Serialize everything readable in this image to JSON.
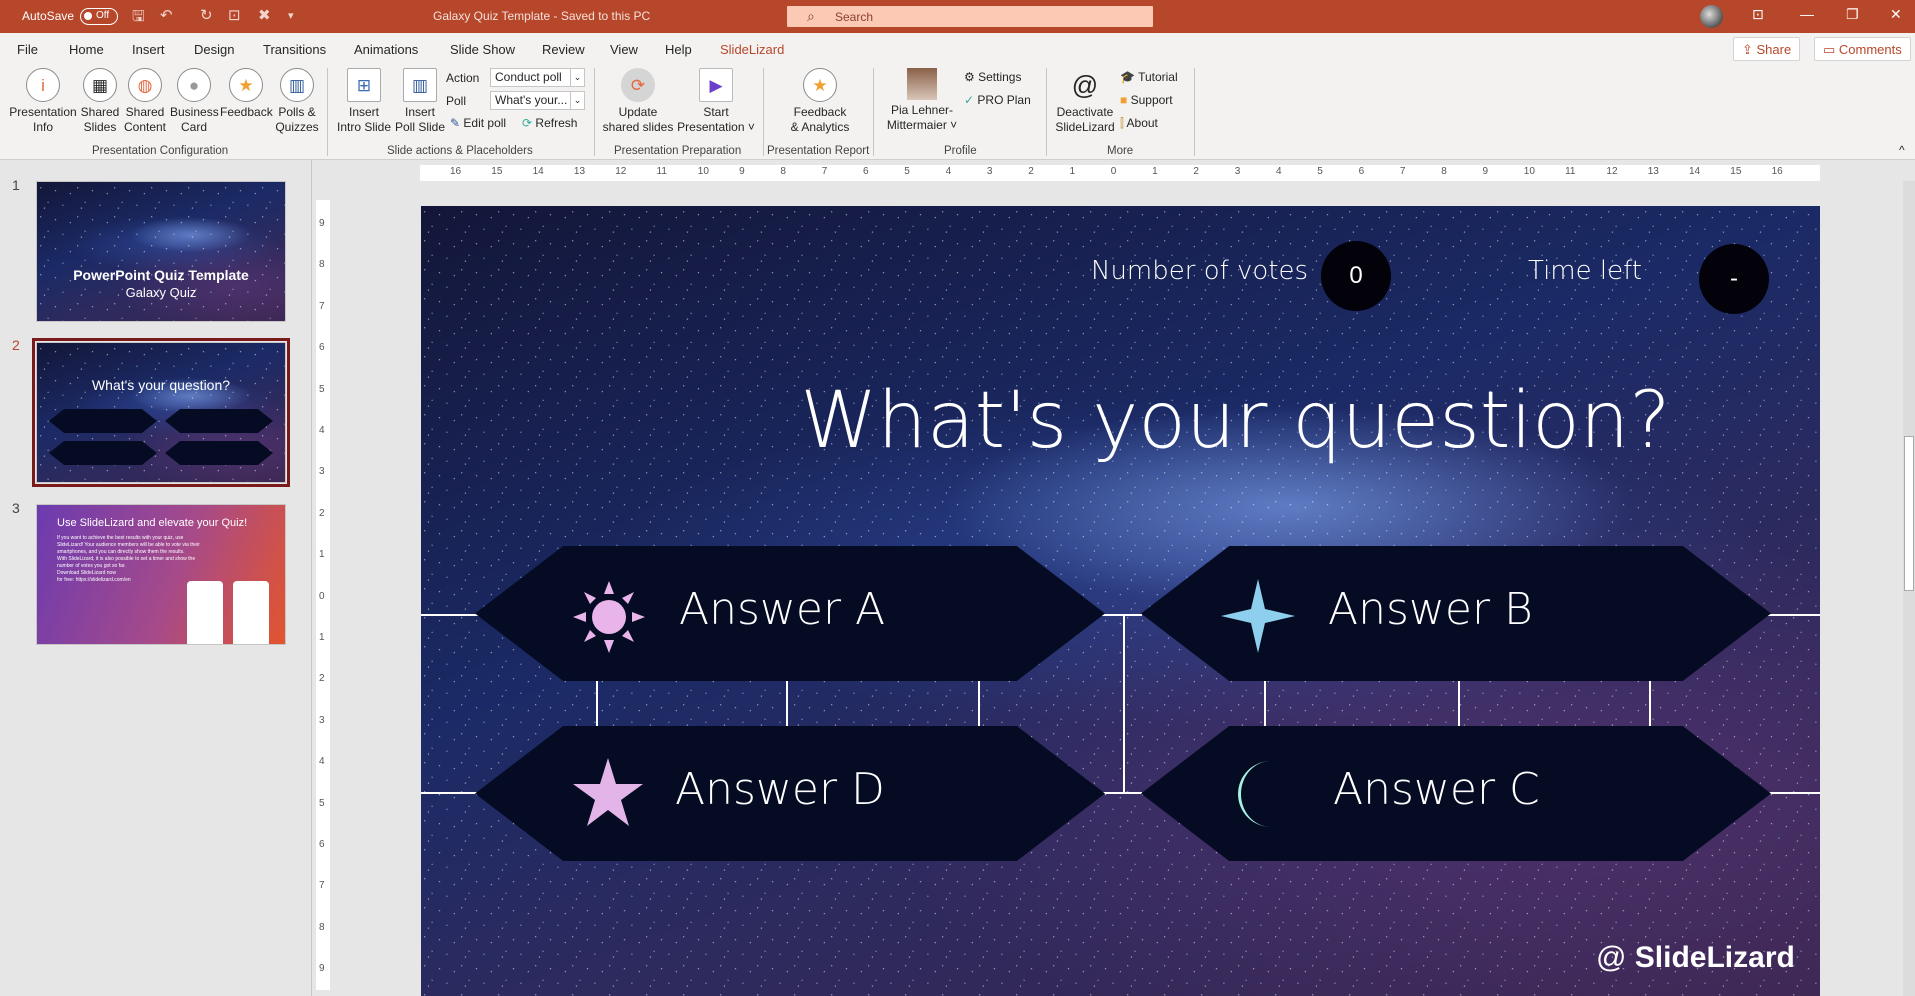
{
  "titlebar": {
    "autosave": "AutoSave",
    "autosave_state": "Off",
    "doc_title": "Galaxy Quiz Template  -  Saved to this PC",
    "search_placeholder": "Search"
  },
  "menu": {
    "tabs": [
      "File",
      "Home",
      "Insert",
      "Design",
      "Transitions",
      "Animations",
      "Slide Show",
      "Review",
      "View",
      "Help",
      "SlideLizard"
    ],
    "active": "SlideLizard",
    "share": "Share",
    "comments": "Comments"
  },
  "ribbon": {
    "groups": [
      "Presentation Configuration",
      "Slide actions & Placeholders",
      "Presentation Preparation",
      "Presentation Report",
      "Profile",
      "More"
    ],
    "config": [
      {
        "l1": "Presentation",
        "l2": "Info"
      },
      {
        "l1": "Shared",
        "l2": "Slides"
      },
      {
        "l1": "Shared",
        "l2": "Content"
      },
      {
        "l1": "Business",
        "l2": "Card"
      },
      {
        "l1": "Feedback",
        "l2": ""
      },
      {
        "l1": "Polls &",
        "l2": "Quizzes"
      }
    ],
    "insert_intro": {
      "l1": "Insert",
      "l2": "Intro Slide"
    },
    "insert_poll": {
      "l1": "Insert",
      "l2": "Poll Slide"
    },
    "action_label": "Action",
    "action_value": "Conduct poll",
    "poll_label": "Poll",
    "poll_value": "What's your...",
    "edit_poll": "Edit poll",
    "refresh": "Refresh",
    "update": {
      "l1": "Update",
      "l2": "shared slides"
    },
    "start": {
      "l1": "Start",
      "l2": "Presentation ˅"
    },
    "feedback": {
      "l1": "Feedback",
      "l2": "& Analytics"
    },
    "profile": {
      "l1": "Pia Lehner-",
      "l2": "Mittermaier ˅"
    },
    "settings": "Settings",
    "pro": "PRO Plan",
    "deactivate": {
      "l1": "Deactivate",
      "l2": "SlideLizard"
    },
    "tutorial": "Tutorial",
    "support": "Support",
    "about": "About"
  },
  "slides": [
    {
      "num": "1",
      "title": "PowerPoint Quiz Template",
      "subtitle": "Galaxy Quiz"
    },
    {
      "num": "2",
      "title": "What's your question?"
    },
    {
      "num": "3",
      "title": "Use SlideLizard and elevate your Quiz!",
      "lines": [
        "If you want to achieve the best results with your quiz, use SlideLizard! Your audience members will be able to vote via their smartphones, and you can directly show them the results.",
        "With SlideLizard, it is also possible to set a timer and show the number of votes you got so far.",
        "Download SlideLizard now",
        "for free: https://slidelizard.com/en"
      ]
    }
  ],
  "ruler_h": [
    "16",
    "15",
    "14",
    "13",
    "12",
    "11",
    "10",
    "9",
    "8",
    "7",
    "6",
    "5",
    "4",
    "3",
    "2",
    "1",
    "0",
    "1",
    "2",
    "3",
    "4",
    "5",
    "6",
    "7",
    "8",
    "9",
    "10",
    "11",
    "12",
    "13",
    "14",
    "15",
    "16"
  ],
  "ruler_v": [
    "9",
    "8",
    "7",
    "6",
    "5",
    "4",
    "3",
    "2",
    "1",
    "0",
    "1",
    "2",
    "3",
    "4",
    "5",
    "6",
    "7",
    "8",
    "9"
  ],
  "slide": {
    "votes_label": "Number of votes",
    "votes_value": "0",
    "time_label": "Time left",
    "time_value": "-",
    "question": "What's your question?",
    "answers": [
      {
        "label": "Answer A",
        "icon": "sun-icon",
        "color": "#e8b4ea"
      },
      {
        "label": "Answer B",
        "icon": "four-point-star-icon",
        "color": "#8ecfee"
      },
      {
        "label": "Answer D",
        "icon": "star-icon",
        "color": "#e2b4e8"
      },
      {
        "label": "Answer C",
        "icon": "crescent-moon-icon",
        "color": "#a4f0e2"
      }
    ],
    "brand": "SlideLizard"
  }
}
